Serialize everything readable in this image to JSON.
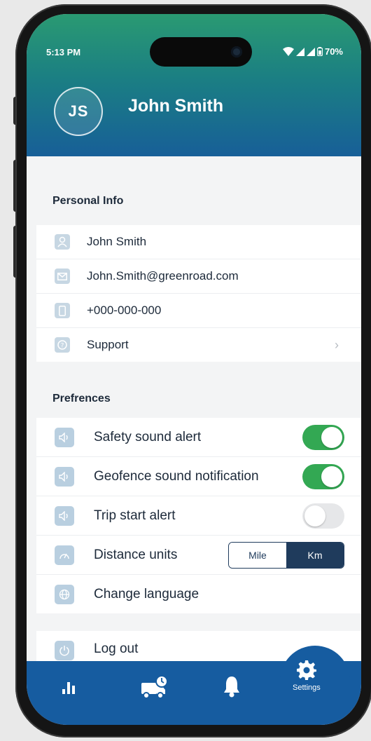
{
  "status_bar": {
    "time": "5:13 PM",
    "battery": "70%"
  },
  "profile": {
    "initials": "JS",
    "name": "John Smith"
  },
  "personal_info": {
    "title": "Personal Info",
    "items": [
      {
        "icon": "user-icon",
        "label": "John Smith"
      },
      {
        "icon": "mail-icon",
        "label": "John.Smith@greenroad.com"
      },
      {
        "icon": "phone-icon",
        "label": "+000-000-000"
      },
      {
        "icon": "help-icon",
        "label": "Support",
        "chevron": "›"
      }
    ]
  },
  "preferences": {
    "title": "Prefrences",
    "items": [
      {
        "icon": "speaker-icon",
        "label": "Safety sound alert",
        "toggle": true
      },
      {
        "icon": "speaker-icon",
        "label": "Geofence sound notification",
        "toggle": true
      },
      {
        "icon": "speaker-icon",
        "label": "Trip start alert",
        "toggle": false
      },
      {
        "icon": "gauge-icon",
        "label": "Distance units",
        "options": [
          "Mile",
          "Km"
        ],
        "selected": "Km"
      },
      {
        "icon": "globe-icon",
        "label": "Change language"
      }
    ]
  },
  "logout": {
    "icon": "power-icon",
    "label": "Log out"
  },
  "bottom_nav": {
    "items": [
      {
        "icon": "stats-icon"
      },
      {
        "icon": "truck-clock-icon"
      },
      {
        "icon": "bell-icon"
      },
      {
        "icon": "gear-icon",
        "label": "Settings",
        "active": true
      }
    ]
  },
  "colors": {
    "header_top": "#2a9a72",
    "header_bottom": "#175f98",
    "nav_bg": "#165ca0",
    "toggle_on": "#33a853",
    "segment_active": "#1f3b5c"
  }
}
